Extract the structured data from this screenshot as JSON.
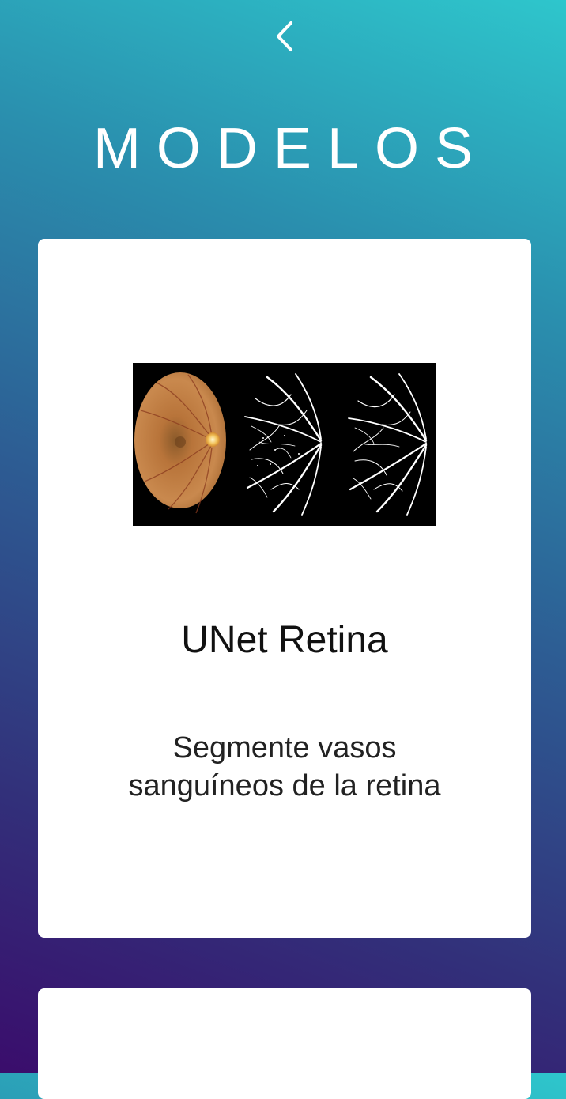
{
  "header": {
    "back_icon": "chevron-left-icon",
    "title": "MODELOS"
  },
  "models": [
    {
      "title": "UNet Retina",
      "description": "Segmente vasos sanguíneos de la retina",
      "image_alt": "retina-fundus-segmentation-image"
    },
    {
      "title": "",
      "description": ""
    }
  ],
  "colors": {
    "gradient_top": "#2ec6cc",
    "gradient_bottom": "#3a0d6c",
    "card_bg": "#ffffff",
    "title_text": "#ffffff"
  }
}
